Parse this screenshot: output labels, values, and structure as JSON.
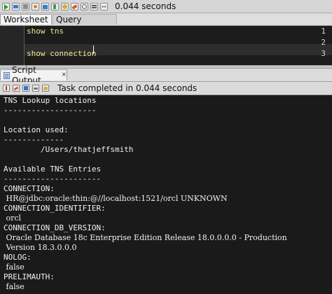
{
  "toolbar": {
    "buttons": [
      "run-statement",
      "run-script",
      "commit",
      "rollback",
      "explain-plan",
      "autotrace",
      "sql-tuning",
      "clear",
      "sql-history",
      "format",
      "unshared"
    ],
    "elapsed": "0.044 seconds"
  },
  "tabs": [
    {
      "label": "Worksheet",
      "active": true
    },
    {
      "label": "Query Builder",
      "active": false
    }
  ],
  "editor": {
    "lines": [
      {
        "number": "1",
        "text": "show tns"
      },
      {
        "number": "2",
        "text": ""
      },
      {
        "number": "3",
        "text": "show connection"
      }
    ],
    "current_line": 3
  },
  "output_panel": {
    "tab_label": "Script Output",
    "tab_close": "×",
    "status": "Task completed in 0.044 seconds",
    "lines": [
      "TNS Lookup locations",
      "--------------------",
      "",
      "Location used:",
      "-------------",
      "        /Users/thatjeffsmith",
      "",
      "Available TNS Entries",
      "---------------------",
      "CONNECTION:",
      " HR@jdbc:oracle:thin:@//localhost:1521/orcl UNKNOWN",
      "CONNECTION_IDENTIFIER:",
      " orcl",
      "CONNECTION_DB_VERSION:",
      " Oracle Database 18c Enterprise Edition Release 18.0.0.0.0 - Production",
      " Version 18.3.0.0.0",
      "NOLOG:",
      " false",
      "PRELIMAUTH:",
      " false"
    ]
  },
  "colors": {
    "editor_background": "#1c1c1c",
    "code_text": "#f0e68c",
    "output_background": "#1a1a1a",
    "output_text": "#f2f2f2"
  }
}
